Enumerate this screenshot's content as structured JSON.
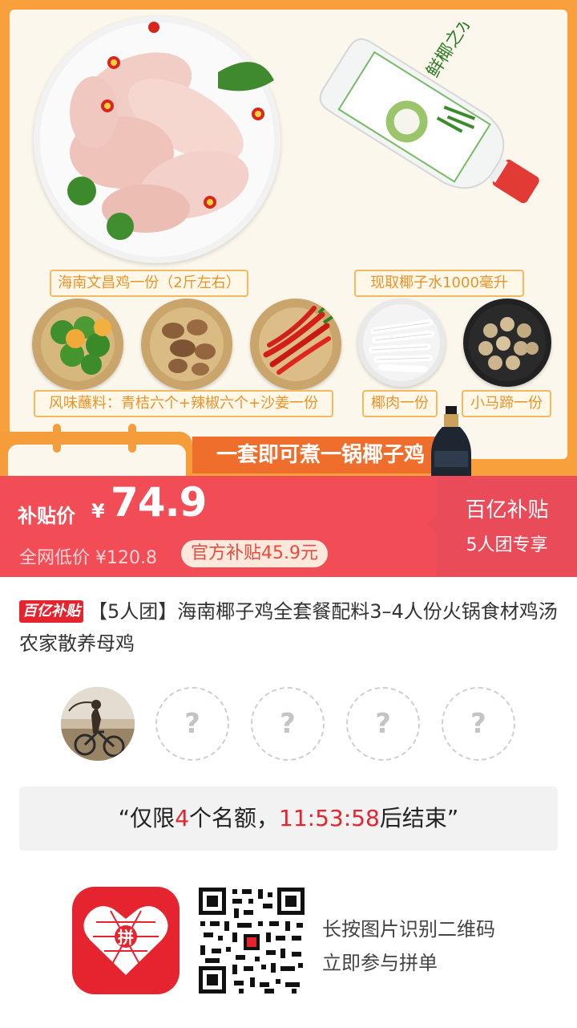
{
  "banner": {
    "labels": {
      "chicken": "海南文昌鸡一份（2斤左右）",
      "coconut_water": "现取椰子水1000毫升",
      "dipping": "风味蘸料：青桔六个+辣椒六个+沙姜一份",
      "coconut_meat": "椰肉一份",
      "water_chestnut": "小马蹄一份"
    },
    "slogan": "一套即可煮一锅椰子鸡",
    "bottle_text": "鲜椰之水"
  },
  "price": {
    "label": "补贴价",
    "currency": "¥",
    "value": "74.9",
    "original": "全网低价 ¥120.8",
    "subsidy": "官方补贴45.9元",
    "promo_line1": "百亿补贴",
    "promo_line2": "5人团专享"
  },
  "product": {
    "badge": "百亿补贴",
    "title": "【5人团】海南椰子鸡全套餐配料3–4人份火锅食材鸡汤农家散养母鸡"
  },
  "group": {
    "placeholder": "?"
  },
  "countdown": {
    "prefix": "“仅限",
    "count": "4",
    "middle": "个名额，",
    "time": "11:53:58",
    "suffix": "后结束”"
  },
  "footer": {
    "line1": "长按图片识别二维码",
    "line2": "立即参与拼单",
    "logo_text": "拼"
  },
  "colors": {
    "brand_red": "#e5242f",
    "price_red": "#f24d57",
    "banner_orange": "#f7a03c"
  }
}
